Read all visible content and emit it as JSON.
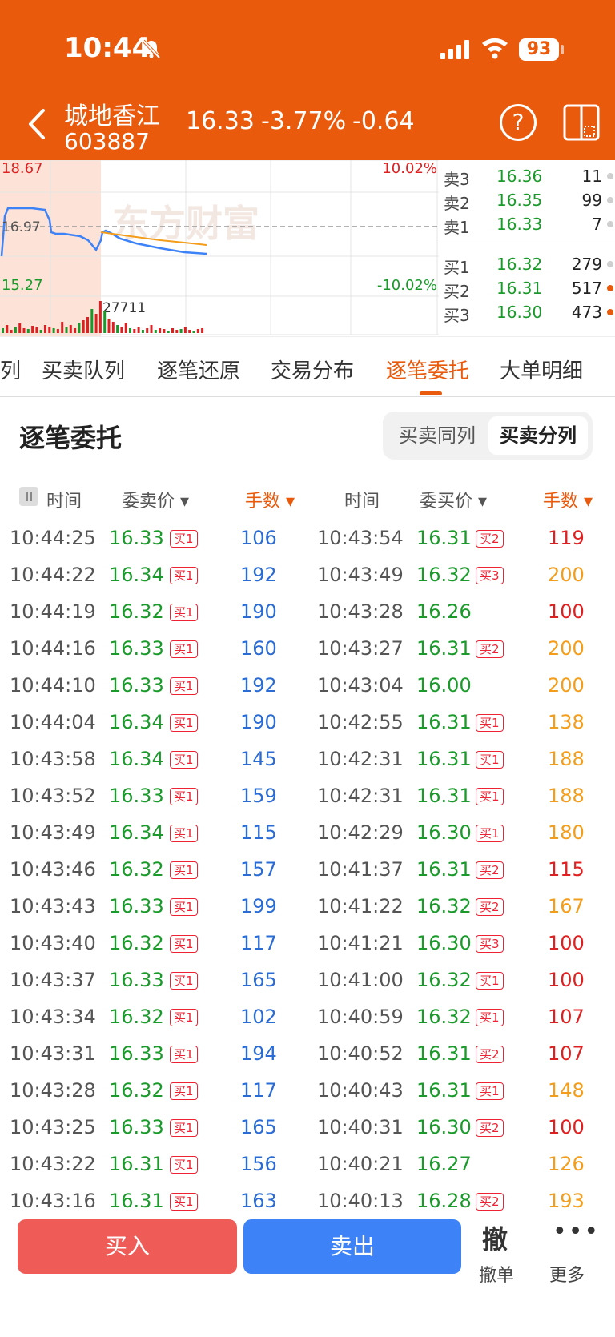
{
  "status": {
    "time": "10:44",
    "battery": "93"
  },
  "header": {
    "name": "城地香江",
    "code": "603887",
    "price": "16.33",
    "pct": "-3.77%",
    "change": "-0.64"
  },
  "chart": {
    "high_label": "18.67",
    "prev_close_label": "16.97",
    "low_label": "15.27",
    "up_pct": "10.02%",
    "down_pct": "-10.02%",
    "volume_label": "27711",
    "watermark": "东方财富"
  },
  "order_book": [
    {
      "label": "卖3",
      "price": "16.36",
      "vol": "11",
      "dot": "#cfcfcf"
    },
    {
      "label": "卖2",
      "price": "16.35",
      "vol": "99",
      "dot": "#cfcfcf"
    },
    {
      "label": "卖1",
      "price": "16.33",
      "vol": "7",
      "dot": "#cfcfcf"
    },
    {
      "label": "买1",
      "price": "16.32",
      "vol": "279",
      "dot": "#cfcfcf"
    },
    {
      "label": "买2",
      "price": "16.31",
      "vol": "517",
      "dot": "#ea5a0c"
    },
    {
      "label": "买3",
      "price": "16.30",
      "vol": "473",
      "dot": "#ea5a0c"
    }
  ],
  "tabs": [
    "列",
    "买卖队列",
    "逐笔还原",
    "交易分布",
    "逐笔委托",
    "大单明细"
  ],
  "active_tab": "逐笔委托",
  "section_title": "逐笔委托",
  "segment": {
    "left": "买卖同列",
    "right": "买卖分列"
  },
  "columns": {
    "time": "时间",
    "sell_price": "委卖价",
    "lots": "手数",
    "buy_price": "委买价"
  },
  "sell_rows": [
    [
      "10:44:25",
      "16.33",
      "买1",
      "106"
    ],
    [
      "10:44:22",
      "16.34",
      "买1",
      "192"
    ],
    [
      "10:44:19",
      "16.32",
      "买1",
      "190"
    ],
    [
      "10:44:16",
      "16.33",
      "买1",
      "160"
    ],
    [
      "10:44:10",
      "16.33",
      "买1",
      "192"
    ],
    [
      "10:44:04",
      "16.34",
      "买1",
      "190"
    ],
    [
      "10:43:58",
      "16.34",
      "买1",
      "145"
    ],
    [
      "10:43:52",
      "16.33",
      "买1",
      "159"
    ],
    [
      "10:43:49",
      "16.34",
      "买1",
      "115"
    ],
    [
      "10:43:46",
      "16.32",
      "买1",
      "157"
    ],
    [
      "10:43:43",
      "16.33",
      "买1",
      "199"
    ],
    [
      "10:43:40",
      "16.32",
      "买1",
      "117"
    ],
    [
      "10:43:37",
      "16.33",
      "买1",
      "165"
    ],
    [
      "10:43:34",
      "16.32",
      "买1",
      "102"
    ],
    [
      "10:43:31",
      "16.33",
      "买1",
      "194"
    ],
    [
      "10:43:28",
      "16.32",
      "买1",
      "117"
    ],
    [
      "10:43:25",
      "16.33",
      "买1",
      "165"
    ],
    [
      "10:43:22",
      "16.31",
      "买1",
      "156"
    ],
    [
      "10:43:16",
      "16.31",
      "买1",
      "163"
    ]
  ],
  "buy_rows": [
    [
      "10:43:54",
      "16.31",
      "买2",
      "119",
      "red"
    ],
    [
      "10:43:49",
      "16.32",
      "买3",
      "200",
      "org"
    ],
    [
      "10:43:28",
      "16.26",
      "",
      "100",
      "red"
    ],
    [
      "10:43:27",
      "16.31",
      "买2",
      "200",
      "org"
    ],
    [
      "10:43:04",
      "16.00",
      "",
      "200",
      "org"
    ],
    [
      "10:42:55",
      "16.31",
      "买1",
      "138",
      "org"
    ],
    [
      "10:42:31",
      "16.31",
      "买1",
      "188",
      "org"
    ],
    [
      "10:42:31",
      "16.31",
      "买1",
      "188",
      "org"
    ],
    [
      "10:42:29",
      "16.30",
      "买1",
      "180",
      "org"
    ],
    [
      "10:41:37",
      "16.31",
      "买2",
      "115",
      "red"
    ],
    [
      "10:41:22",
      "16.32",
      "买2",
      "167",
      "org"
    ],
    [
      "10:41:21",
      "16.30",
      "买3",
      "100",
      "red"
    ],
    [
      "10:41:00",
      "16.32",
      "买1",
      "100",
      "red"
    ],
    [
      "10:40:59",
      "16.32",
      "买1",
      "107",
      "red"
    ],
    [
      "10:40:52",
      "16.31",
      "买2",
      "107",
      "red"
    ],
    [
      "10:40:43",
      "16.31",
      "买1",
      "148",
      "org"
    ],
    [
      "10:40:31",
      "16.30",
      "买2",
      "100",
      "red"
    ],
    [
      "10:40:21",
      "16.27",
      "",
      "126",
      "org"
    ],
    [
      "10:40:13",
      "16.28",
      "买2",
      "193",
      "org"
    ]
  ],
  "bottom": {
    "buy": "买入",
    "sell": "卖出",
    "cancel_icon": "撤",
    "cancel": "撤单",
    "more_icon": "•••",
    "more": "更多"
  }
}
